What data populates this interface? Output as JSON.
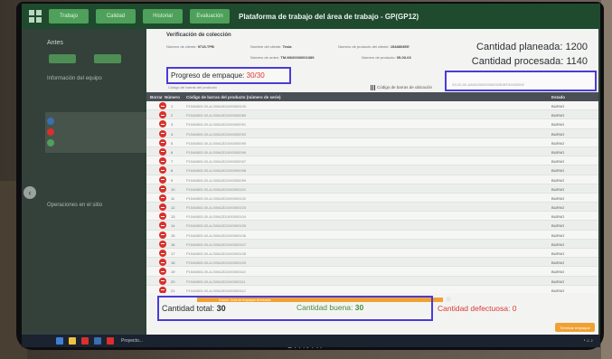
{
  "app": {
    "title": "Plataforma de trabajo del área de trabajo - GP(GP12)",
    "tabs": [
      "Trabajo",
      "Calidad",
      "Historial",
      "Evaluación"
    ]
  },
  "sidebar": {
    "section1": "Antes",
    "section2": "Información del equipo",
    "section3": "Operaciones en el sitio"
  },
  "dialog": {
    "title": "Verificación de colección",
    "meta": [
      {
        "label": "Número de cliente:",
        "value": "9715-TPB"
      },
      {
        "label": "Nombre del cliente:",
        "value": "Tesla"
      },
      {
        "label": "Número de producto del cliente:",
        "value": "1548803EE"
      },
      {
        "label": "Número de orden:",
        "value": "TM-M020000001089"
      },
      {
        "label": "Número de producto:",
        "value": "05-00-03"
      }
    ],
    "planned_label": "Cantidad planeada:",
    "planned_value": "1200",
    "processed_label": "Cantidad procesada:",
    "processed_value": "1140",
    "progress_label": "Progreso de empaque:",
    "progress_value": "30/30",
    "caja_caption": "Código de barras del producto",
    "barcode_label": "Código de barras de ubicación",
    "barcode_value": "Z9-00-00-AA00000000000000DBF00000000"
  },
  "table": {
    "headers": {
      "action": "Borrar",
      "number": "Número",
      "serial": "Código de barras del producto (número de serie)",
      "status": "Estado"
    },
    "rows": [
      {
        "n": "1",
        "serial": "P1546803-00-A-000A2D1000000100",
        "status": "BUENO"
      },
      {
        "n": "2",
        "serial": "P1546803-00-A-000A2D1000000089",
        "status": "BUENO"
      },
      {
        "n": "3",
        "serial": "P1546803-00-A-000A2D1000000091",
        "status": "BUENO"
      },
      {
        "n": "4",
        "serial": "P1546803-00-A-000A2D1000000093",
        "status": "BUENO"
      },
      {
        "n": "5",
        "serial": "P1546803-00-A-000A2D1000000095",
        "status": "BUENO"
      },
      {
        "n": "6",
        "serial": "P1546803-00-A-000A2D1000000096",
        "status": "BUENO"
      },
      {
        "n": "7",
        "serial": "P1546803-00-A-000A2D1000000097",
        "status": "BUENO"
      },
      {
        "n": "8",
        "serial": "P1546803-00-A-000A2D1000000098",
        "status": "BUENO"
      },
      {
        "n": "9",
        "serial": "P1546803-00-A-000A2D1000000099",
        "status": "BUENO"
      },
      {
        "n": "10",
        "serial": "P1546803-00-A-000A2D1000000101",
        "status": "BUENO"
      },
      {
        "n": "11",
        "serial": "P1546803-00-A-000A2D1000000102",
        "status": "BUENO"
      },
      {
        "n": "12",
        "serial": "P1546803-00-A-000A2D1000000103",
        "status": "BUENO"
      },
      {
        "n": "13",
        "serial": "P1546803-00-A-000A2D1000000104",
        "status": "BUENO"
      },
      {
        "n": "14",
        "serial": "P1546803-00-A-000A2D1000000105",
        "status": "BUENO"
      },
      {
        "n": "15",
        "serial": "P1546803-00-A-000A2D1000000106",
        "status": "BUENO"
      },
      {
        "n": "16",
        "serial": "P1546803-00-A-000A2D1000000107",
        "status": "BUENO"
      },
      {
        "n": "17",
        "serial": "P1546803-00-A-000A2D1000000108",
        "status": "BUENO"
      },
      {
        "n": "18",
        "serial": "P1546803-00-A-000A2D1000000109",
        "status": "BUENO"
      },
      {
        "n": "19",
        "serial": "P1546803-00-A-000A2D1000000110",
        "status": "BUENO"
      },
      {
        "n": "20",
        "serial": "P1546803-00-A-000A2D1000000111",
        "status": "BUENO"
      },
      {
        "n": "21",
        "serial": "P1546803-00-A-000A2D1000000112",
        "status": "BUENO"
      }
    ]
  },
  "footer": {
    "orange_text": "Estado: Guía de empaque terminada",
    "total_label": "Cantidad total:",
    "total_value": "30",
    "good_label": "Cantidad buena:",
    "good_value": "30",
    "bad_label": "Cantidad defectuosa:",
    "bad_value": "0",
    "finish_label": "Terminar empaque"
  },
  "taskbar": {
    "text": "Proyecto..."
  },
  "monitor_brand": "LANIX",
  "colors": {
    "highlight": "#4b3bd6",
    "accent_green": "#4ea05a",
    "danger": "#d9302b",
    "orange": "#f0a134"
  }
}
